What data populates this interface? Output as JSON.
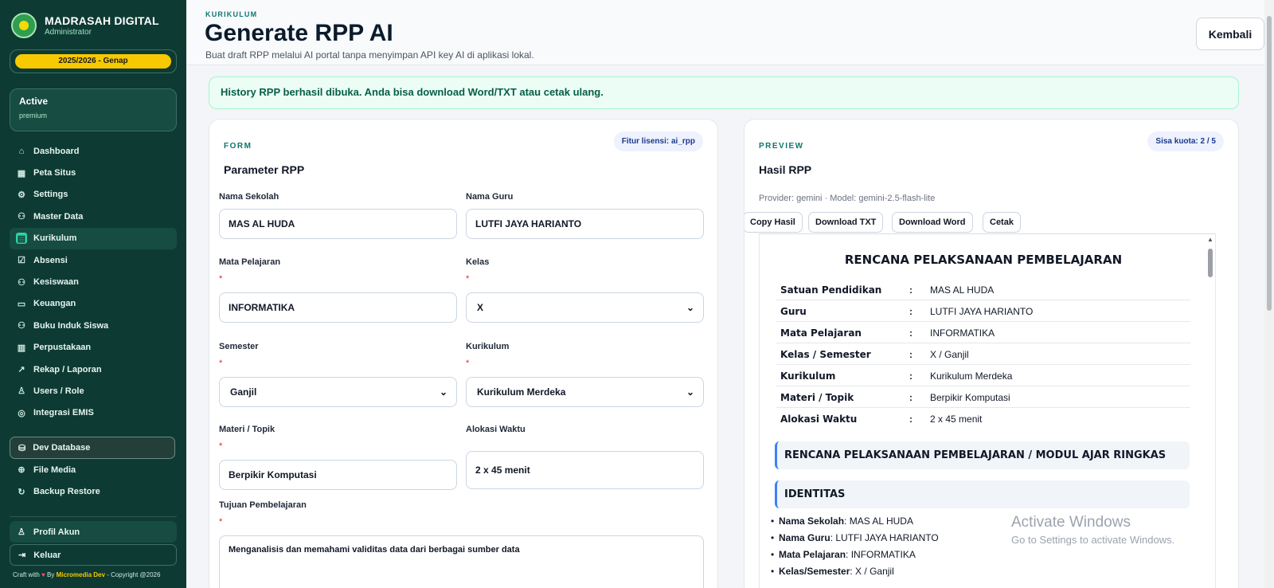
{
  "sidebar": {
    "brand_title": "MADRASAH DIGITAL",
    "brand_sub": "Administrator",
    "year": "2025/2026 - Genap",
    "status_title": "Active",
    "status_sub": "premium",
    "items": [
      {
        "label": "Dashboard",
        "icon": "home-icon"
      },
      {
        "label": "Peta Situs",
        "icon": "grid-icon"
      },
      {
        "label": "Settings",
        "icon": "gear-icon"
      },
      {
        "label": "Master Data",
        "icon": "users-icon"
      },
      {
        "label": "Kurikulum",
        "icon": "calendar-icon"
      },
      {
        "label": "Absensi",
        "icon": "check-square-icon"
      },
      {
        "label": "Kesiswaan",
        "icon": "users-icon"
      },
      {
        "label": "Keuangan",
        "icon": "wallet-icon"
      },
      {
        "label": "Buku Induk Siswa",
        "icon": "users-icon"
      },
      {
        "label": "Perpustakaan",
        "icon": "book-icon"
      },
      {
        "label": "Rekap / Laporan",
        "icon": "chart-icon"
      },
      {
        "label": "Users / Role",
        "icon": "user-icon"
      },
      {
        "label": "Integrasi EMIS",
        "icon": "target-icon"
      }
    ],
    "dev_database": "Dev Database",
    "items2": [
      {
        "label": "File Media",
        "icon": "plus-circle-icon"
      },
      {
        "label": "Backup Restore",
        "icon": "refresh-icon"
      }
    ],
    "profil": "Profil Akun",
    "keluar": "Keluar",
    "footer": {
      "prefix": "Craft with",
      "by": "By",
      "brand": "Micromedia Dev",
      "suffix": "- Copyright @2026"
    }
  },
  "header": {
    "kicker": "KURIKULUM",
    "title": "Generate RPP AI",
    "subtitle": "Buat draft RPP melalui AI portal tanpa menyimpan API key AI di aplikasi lokal.",
    "back_button": "Kembali"
  },
  "alert": "History RPP berhasil dibuka. Anda bisa download Word/TXT atau cetak ulang.",
  "form": {
    "kicker": "FORM",
    "title": "Parameter RPP",
    "license_pill": "Fitur lisensi: ai_rpp",
    "required_mark": "*",
    "nama_sekolah": {
      "label": "Nama Sekolah",
      "value": "MAS AL HUDA"
    },
    "nama_guru": {
      "label": "Nama Guru",
      "value": "LUTFI JAYA HARIANTO"
    },
    "mata_pelajaran": {
      "label": "Mata Pelajaran",
      "value": "INFORMATIKA"
    },
    "kelas": {
      "label": "Kelas",
      "value": "X"
    },
    "semester": {
      "label": "Semester",
      "value": "Ganjil"
    },
    "kurikulum": {
      "label": "Kurikulum",
      "value": "Kurikulum Merdeka"
    },
    "materi": {
      "label": "Materi / Topik",
      "value": "Berpikir Komputasi"
    },
    "alokasi": {
      "label": "Alokasi Waktu",
      "value": "2 x 45 menit"
    },
    "tujuan": {
      "label": "Tujuan Pembelajaran",
      "value": "Menganalisis dan memahami validitas data dari berbagai sumber data"
    }
  },
  "preview": {
    "kicker": "PREVIEW",
    "title": "Hasil RPP",
    "quota_pill": "Sisa kuota: 2 / 5",
    "meta": "Provider: gemini · Model: gemini-2.5-flash-lite",
    "buttons": {
      "copy": "Copy Hasil",
      "txt": "Download TXT",
      "word": "Download Word",
      "print": "Cetak"
    },
    "doc_title": "RENCANA PELAKSANAAN PEMBELAJARAN",
    "colon": ":",
    "info": [
      {
        "k": "Satuan Pendidikan",
        "v": "MAS AL HUDA"
      },
      {
        "k": "Guru",
        "v": "LUTFI JAYA HARIANTO"
      },
      {
        "k": "Mata Pelajaran",
        "v": "INFORMATIKA"
      },
      {
        "k": "Kelas / Semester",
        "v": "X / Ganjil"
      },
      {
        "k": "Kurikulum",
        "v": "Kurikulum Merdeka"
      },
      {
        "k": "Materi / Topik",
        "v": "Berpikir Komputasi"
      },
      {
        "k": "Alokasi Waktu",
        "v": "2 x 45 menit"
      }
    ],
    "section1": "RENCANA PELAKSANAAN PEMBELAJARAN / MODUL AJAR RINGKAS",
    "section2": "IDENTITAS",
    "bullets": [
      {
        "k": "Nama Sekolah",
        "v": ": MAS AL HUDA"
      },
      {
        "k": "Nama Guru",
        "v": ": LUTFI JAYA HARIANTO"
      },
      {
        "k": "Mata Pelajaran",
        "v": ": INFORMATIKA"
      },
      {
        "k": "Kelas/Semester",
        "v": ": X / Ganjil"
      }
    ]
  },
  "watermark": {
    "line1": "Activate Windows",
    "line2": "Go to Settings to activate Windows."
  }
}
